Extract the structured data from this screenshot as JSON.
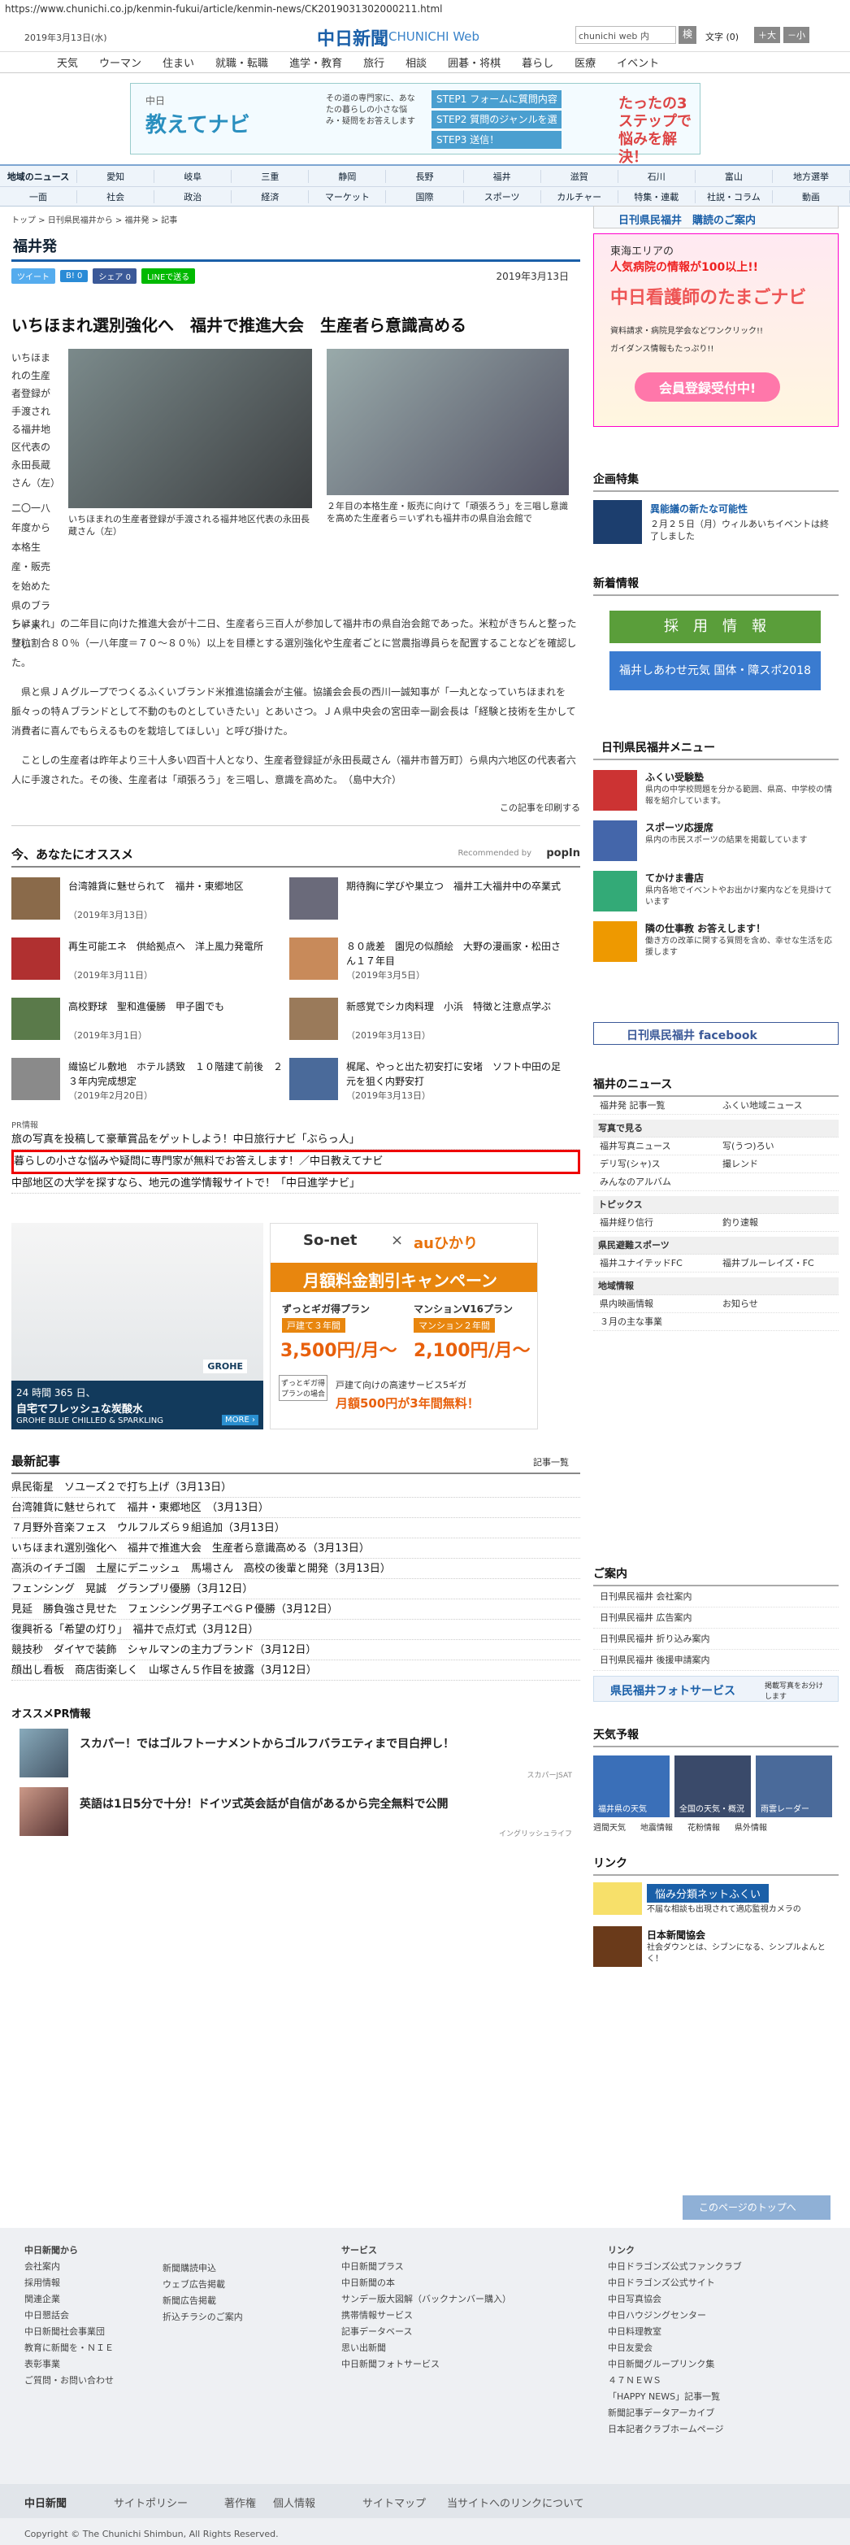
{
  "url": "https://www.chunichi.co.jp/kenmin-fukui/article/kenmin-news/CK2019031302000211.html",
  "top": {
    "date": "2019年3月13日(水)",
    "logo": "中日新聞",
    "logo_sub": "CHUNICHI Web",
    "search": "chunichi web 内",
    "search_btn": "検",
    "moji": "文字 (0)",
    "big": "＋大",
    "small": "－小"
  },
  "catnav": [
    "天気",
    "ウーマン",
    "住まい",
    "就職・転職",
    "進学・教育",
    "旅行",
    "相談",
    "囲碁・将棋",
    "暮らし",
    "医療",
    "イベント"
  ],
  "banner": {
    "t1": "中日",
    "t2": "教えてナビ",
    "t3": "その道の専門家に、あなたの暮らしの小さな悩み・疑問をお答えします",
    "s1": "STEP1 フォームに質問内容を入力",
    "s2": "STEP2 質問のジャンルを選択",
    "s3": "STEP3 送信！",
    "t4": "たったの3ステップで悩みを解決！"
  },
  "nav1": [
    "地域のニュース",
    "愛知",
    "岐阜",
    "三重",
    "静岡",
    "長野",
    "福井",
    "滋賀",
    "石川",
    "富山",
    "地方選挙"
  ],
  "nav2": [
    "一面",
    "社会",
    "政治",
    "経済",
    "マーケット",
    "国際",
    "スポーツ",
    "カルチャー",
    "特集・連載",
    "社説・コラム",
    "動画"
  ],
  "crumb": "トップ > 日刊県民福井から > 福井発 > 記事",
  "page_head": "福井発",
  "share": {
    "tw": "ツイート",
    "b": "B! 0",
    "fb": "シェア 0",
    "line": "LINEで送る"
  },
  "article_date": "2019年3月13日",
  "headline": "いちほまれ選別強化へ　福井で推進大会　生産者ら意識高める",
  "side_note": "いちほまれの生産者登録が手渡される福井地区代表の永田長蔵さん（左）",
  "cap1": "いちほまれの生産者登録が手渡される福井地区代表の永田長蔵さん（左）",
  "cap2": "２年目の本格生産・販売に向けて「頑張ろう」を三唱し意識を高めた生産者ら＝いずれも福井市の県自治会館で",
  "p1a": "二〇一八年度から本格生産・販売を始めた県のブランド米「い",
  "p1b": "ちほまれ」の二年目に向けた推進大会が十二日、生産者ら三百人が参加して福井市の県自治会館であった。米粒がきちんと整った整粒割合８０％（一八年度＝７０～８０％）以上を目標とする選別強化や生産者ごとに営農指導員らを配置することなどを確認した。",
  "p2": "県と県ＪＡグループでつくるふくいブランド米推進協議会が主催。協議会会長の西川一誠知事が「一丸となっていちほまれを脈々っの特Ａブランドとして不動のものとしていきたい」とあいさつ。ＪＡ県中央会の宮田幸一副会長は「経験と技術を生かして消費者に喜んでもらえるものを栽培してほしい」と呼び掛けた。",
  "p3": "ことしの生産者は昨年より三十人多い四百十人となり、生産者登録証が永田長蔵さん（福井市普万町）ら県内六地区の代表者六人に手渡された。その後、生産者は「頑張ろう」を三唱し、意識を高めた。　（島中大介）",
  "print": "この記事を印刷する",
  "osusume_head": "今、あなたにオススメ",
  "recommended": "Recommended by",
  "popin": "popIn",
  "recs": [
    {
      "t": "台湾雑貨に魅せられて　福井・東郷地区",
      "d": "（2019年3月13日）"
    },
    {
      "t": "期待胸に学びや巣立つ　福井工大福井中の卒業式",
      "d": ""
    },
    {
      "t": "再生可能エネ　供給拠点へ　洋上風力発電所",
      "d": "（2019年3月11日）"
    },
    {
      "t": "８０歳差　園児の似顔絵　大野の漫画家・松田さん１７年目",
      "d": "（2019年3月5日）"
    },
    {
      "t": "高校野球　聖和進優勝　甲子園でも",
      "d": "（2019年3月1日）"
    },
    {
      "t": "新感覚でシカ肉料理　小浜　特徴と注意点学ぶ",
      "d": "（2019年3月13日）"
    },
    {
      "t": "繊協ビル敷地　ホテル誘致　１０階建て前後　２３年内完成想定",
      "d": "（2019年2月20日）"
    },
    {
      "t": "梶尾、やっと出た初安打に安堵　ソフト中田の足元を狙く内野安打",
      "d": "（2019年3月13日）"
    }
  ],
  "pr_label": "PR情報",
  "pr": [
    "旅の写真を投稿して豪華賞品をゲットしよう！中日旅行ナビ「ぶらっ人」",
    "暮らしの小さな悩みや疑問に専門家が無料でお答えします！／中日教えてナビ",
    "中部地区の大学を探すなら、地元の進学情報サイトで！「中日進学ナビ」"
  ],
  "ad1": {
    "t1": "24 時間 365 日、",
    "t2": "自宅でフレッシュな炭酸水",
    "t3": "GROHE BLUE CHILLED & SPARKLING",
    "more": "MORE ›",
    "brand": "GROHE"
  },
  "ad2": {
    "a": "So-net",
    "x": "×",
    "b": "auひかり",
    "title": "月額料金割引キャンペーン",
    "p1": "ずっとギガ得プラン",
    "p1b": "戸建て３年間",
    "p1c": "3,500円/月～",
    "p2": "マンションV16プラン",
    "p2b": "マンション２年間",
    "p2c": "2,100円/月～",
    "note": "戸建て向けの高速サービス5ギガ",
    "note2": "月額500円が3年間無料！",
    "small": "ずっとギガ得プランの場合"
  },
  "latest_head": "最新記事",
  "latest_more": "記事一覧",
  "latest": [
    "県民衛星　ソユーズ２で打ち上げ（3月13日）",
    "台湾雑貨に魅せられて　福井・東郷地区　（3月13日）",
    "７月野外音楽フェス　ウルフルズら９組追加（3月13日）",
    "いちほまれ選別強化へ　福井で推進大会　生産者ら意識高める（3月13日）",
    "高浜のイチゴ園　土屋にデニッシュ　馬場さん　高校の後輩と開発（3月13日）",
    "フェンシング　晃誠　グランプリ優勝（3月12日）",
    "見延　勝負強さ見せた　フェンシング男子エペＧＰ優勝（3月12日）",
    "復興祈る「希望の灯り」　福井で点灯式（3月12日）",
    "競技秒　ダイヤで装飾　シャルマンの主力ブランド（3月12日）",
    "顔出し看板　商店街楽しく　山塚さん５作目を披露（3月12日）"
  ],
  "oprhead": "オススメPR情報",
  "opr": [
    {
      "t": "スカパー！ではゴルフトーナメントからゴルフバラエティまで目白押し！",
      "s": "スカパーJSAT"
    },
    {
      "t": "英語は1日5分で十分！ドイツ式英会話が自信があるから完全無料で公開",
      "s": "イングリッシュライフ"
    }
  ],
  "right": {
    "subs": "日刊県民福井　購読のご案内",
    "nurse1": "東海エリアの",
    "nurse2": "人気病院の情報が100以上!!",
    "nurse3": "中日看護師のたまごナビ",
    "nurse4": "資料請求・病院見学会などワンクリック!!",
    "nurse5": "ガイダンス情報もたっぷり!!",
    "nurse6": "会員登録受付中!",
    "kikaku": "企画特集",
    "kikaku_t": "異能議の新たな可能性",
    "kikaku_d": "２月２５日（月）ウィルあいちイベントは終了しました",
    "shinsha": "新着情報",
    "saiyo": "採　用　情　報",
    "kokutai": "福井しあわせ元気 国体・障スポ2018",
    "menu_head": "日刊県民福井メニュー",
    "menu": [
      {
        "t": "ふくい受験塾",
        "d": "県内の中学校問題を分かる範囲、県高、中学校の情報を紹介しています。"
      },
      {
        "t": "スポーツ応援席",
        "d": "県内の市民スポーツの結果を掲載しています"
      },
      {
        "t": "てかけま書店",
        "d": "県内各地でイベントやお出かけ案内などを見掛けています"
      },
      {
        "t": "隣の仕事教 お答えします！",
        "d": "働き方の改革に関する質問を含め、幸せな生活を応援します"
      }
    ],
    "fb": "日刊県民福井 facebook",
    "news_head": "福井のニュース",
    "n1": [
      "福井発 記事一覧",
      "ふくい地域ニュース"
    ],
    "n2h": "写真で見る",
    "n3": [
      "福井写真ニュース",
      "写(うつ)ろい"
    ],
    "n4": [
      "デリ写(シャ)ス",
      "撮レンド"
    ],
    "n5": [
      "みんなのアルバム"
    ],
    "n6h": "トピックス",
    "n7": [
      "福井経り信行",
      "釣り速報"
    ],
    "n8h": "県民避難スポーツ",
    "n9": [
      "福井ユナイテッドFC",
      "福井ブルーレイズ・FC"
    ],
    "n10h": "地域情報",
    "n11": [
      "県内映画情報",
      "お知らせ"
    ],
    "n12": [
      "３月の主な事業"
    ],
    "annai_head": "ご案内",
    "annai": [
      "日刊県民福井 会社案内",
      "日刊県民福井 広告案内",
      "日刊県民福井 折り込み案内",
      "日刊県民福井 後援申請案内"
    ],
    "photo": "県民福井フォトサービス",
    "photo_note": "掲載写真をお分けします",
    "weather_head": "天気予報",
    "w": [
      "福井県の天気",
      "全国の天気・概況",
      "雨雲レーダー"
    ],
    "w2": [
      "週間天気",
      "地震情報",
      "花粉情報",
      "県外情報"
    ],
    "link_head": "リンク",
    "link1": "悩み分類ネットふくい",
    "link1d": "不届な相談も出現されて適応監視カメラの",
    "link2": "日本新聞協会",
    "link2d": "社会ダウンとは、シブンになる、シンプルよんとく！"
  },
  "totop": "このページのトップへ",
  "footer": {
    "c1h": "中日新聞から",
    "c1": [
      "会社案内",
      "採用情報",
      "関連企業",
      "中日懇話会",
      "中日新聞社会事業団",
      "教育に新聞を・ＮＩＥ",
      "表彰事業",
      "ご質問・お問い合わせ"
    ],
    "c2": [
      "新聞購読申込",
      "ウェブ広告掲載",
      "新聞広告掲載",
      "折込チラシのご案内"
    ],
    "c3h": "サービス",
    "c3": [
      "中日新聞プラス",
      "中日新聞の本",
      "サンデー版大図解（バックナンバー購入）",
      "携帯情報サービス",
      "記事データベース",
      "思い出新聞",
      "中日新聞フォトサービス"
    ],
    "c4h": "リンク",
    "c4": [
      "中日ドラゴンズ公式ファンクラブ",
      "中日ドラゴンズ公式サイト",
      "中日写真協会",
      "中日ハウジングセンター",
      "中日料理教室",
      "中日友愛会",
      "中日新聞グループリンク集",
      "４７ＮＥＷＳ",
      "「HAPPY NEWS」記事一覧",
      "新聞記事データアーカイブ",
      "日本記者クラブホームページ"
    ],
    "bar": [
      "中日新聞",
      "サイトポリシー",
      "著作権",
      "個人情報",
      "サイトマップ",
      "当サイトへのリンクについて"
    ],
    "copy": "Copyright © The Chunichi Shimbun, All Rights Reserved."
  }
}
